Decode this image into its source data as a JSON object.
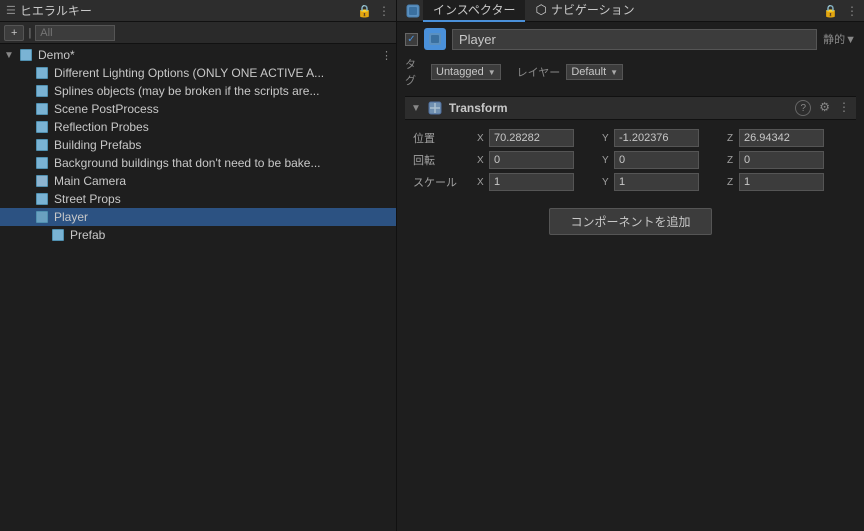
{
  "hierarchy": {
    "panel_title": "ヒエラルキー",
    "add_label": "+",
    "search_placeholder": "All",
    "lock_icon": "🔒",
    "more_icon": "⋮",
    "items": [
      {
        "id": "demo",
        "label": "Demo*",
        "depth": 0,
        "has_arrow": true,
        "arrow_open": true,
        "icon": "cube",
        "three_dot": "⋮"
      },
      {
        "id": "lighting",
        "label": "Different Lighting Options (ONLY ONE ACTIVE A...",
        "depth": 1,
        "has_arrow": false,
        "icon": "cube"
      },
      {
        "id": "splines",
        "label": "Splines objects (may be broken if the scripts are...",
        "depth": 1,
        "has_arrow": false,
        "icon": "cube"
      },
      {
        "id": "scene-postprocess",
        "label": "Scene PostProcess",
        "depth": 1,
        "has_arrow": false,
        "icon": "cube"
      },
      {
        "id": "reflection-probes",
        "label": "Reflection Probes",
        "depth": 1,
        "has_arrow": false,
        "icon": "cube"
      },
      {
        "id": "building-prefabs",
        "label": "Building Prefabs",
        "depth": 1,
        "has_arrow": false,
        "icon": "cube"
      },
      {
        "id": "background-buildings",
        "label": "Background buildings that don't need to be bake...",
        "depth": 1,
        "has_arrow": false,
        "icon": "cube"
      },
      {
        "id": "main-camera",
        "label": "Main Camera",
        "depth": 1,
        "has_arrow": false,
        "icon": "camera"
      },
      {
        "id": "street-props",
        "label": "Street Props",
        "depth": 1,
        "has_arrow": false,
        "icon": "cube"
      },
      {
        "id": "player",
        "label": "Player",
        "depth": 1,
        "has_arrow": false,
        "icon": "cube",
        "selected": true
      },
      {
        "id": "prefab",
        "label": "Prefab",
        "depth": 2,
        "has_arrow": false,
        "icon": "cube"
      }
    ]
  },
  "inspector": {
    "panel_title": "インスペクター",
    "nav_tab": "ナビゲーション",
    "lock_icon": "🔒",
    "more_icon": "⋮",
    "static_label": "静的▼",
    "enabled_check": "✓",
    "object_name": "Player",
    "tag_label": "タグ",
    "tag_value": "Untagged",
    "layer_label": "レイヤー",
    "layer_value": "Default",
    "transform": {
      "title": "Transform",
      "help_icon": "?",
      "settings_icon": "⚙",
      "more_icon": "⋮",
      "position_label": "位置",
      "rotation_label": "回転",
      "scale_label": "スケール",
      "pos_x_label": "X",
      "pos_x_value": "70.28282",
      "pos_y_label": "Y",
      "pos_y_value": "-1.202376",
      "pos_z_label": "Z",
      "pos_z_value": "26.94342",
      "rot_x_label": "X",
      "rot_x_value": "0",
      "rot_y_label": "Y",
      "rot_y_value": "0",
      "rot_z_label": "Z",
      "rot_z_value": "0",
      "scale_x_label": "X",
      "scale_x_value": "1",
      "scale_y_label": "Y",
      "scale_y_value": "1",
      "scale_z_label": "Z",
      "scale_z_value": "1"
    },
    "add_component_label": "コンポーネントを追加"
  }
}
